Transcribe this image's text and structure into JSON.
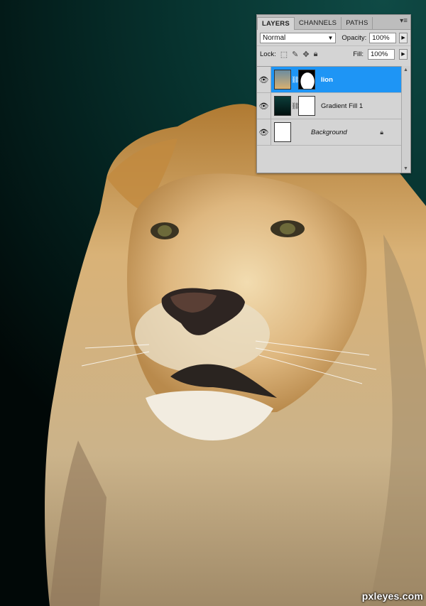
{
  "panel": {
    "tabs": [
      "LAYERS",
      "CHANNELS",
      "PATHS"
    ],
    "blend_mode": "Normal",
    "opacity_label": "Opacity:",
    "opacity_value": "100%",
    "lock_label": "Lock:",
    "fill_label": "Fill:",
    "fill_value": "100%",
    "layers": [
      {
        "name": "lion",
        "selected": true
      },
      {
        "name": "Gradient Fill 1",
        "selected": false
      },
      {
        "name": "Background",
        "selected": false,
        "locked": true
      }
    ]
  },
  "watermark": "pxleyes.com",
  "colors": {
    "selection": "#1e95f5",
    "background_top": "#0f4a45",
    "background_bottom": "#010807"
  }
}
